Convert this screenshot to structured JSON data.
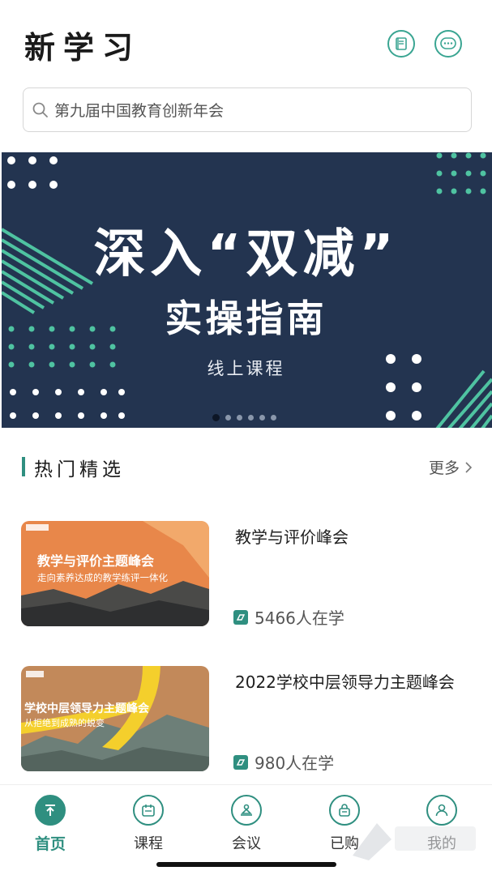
{
  "header": {
    "title": "新学习",
    "book_icon": "book-icon",
    "message_icon": "chat-bubble-icon"
  },
  "search": {
    "placeholder": "第九届中国教育创新年会",
    "icon": "search-icon"
  },
  "banner": {
    "title": "深入“双减”",
    "subtitle": "实操指南",
    "tag": "线上课程",
    "slide_count": 6,
    "active_slide": 1,
    "colors": {
      "background": "#233450",
      "accent": "#4fc3a1"
    }
  },
  "section": {
    "title": "热门精选",
    "more_label": "更多"
  },
  "courses": [
    {
      "title": "教学与评价峰会",
      "learners": "5466人在学",
      "thumb_title": "教学与评价主题峰会",
      "thumb_subtitle": "走向素养达成的教学练评一体化"
    },
    {
      "title": "2022学校中层领导力主题峰会",
      "learners": "980人在学",
      "thumb_title": "学校中层领导力主题峰会",
      "thumb_subtitle": "从拒绝到成熟的蜕变"
    }
  ],
  "tabs": [
    {
      "label": "首页",
      "icon": "home-arrow-icon",
      "active": true
    },
    {
      "label": "课程",
      "icon": "calendar-icon",
      "active": false
    },
    {
      "label": "会议",
      "icon": "podium-icon",
      "active": false
    },
    {
      "label": "已购",
      "icon": "lock-bag-icon",
      "active": false
    },
    {
      "label": "我的",
      "icon": "user-icon",
      "active": false
    }
  ],
  "accent_color": "#2f8f80"
}
